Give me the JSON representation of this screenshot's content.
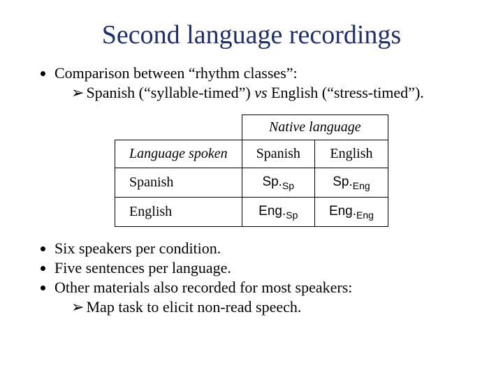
{
  "title": "Second language recordings",
  "bullet1": "Comparison between “rhythm classes”:",
  "bullet1_sub_a": "Spanish (“syllable-timed”) ",
  "bullet1_sub_vs": "vs",
  "bullet1_sub_b": " English (“stress-timed”).",
  "arrow": "➢",
  "table": {
    "native_header": "Native language",
    "row_header_label": "Language spoken",
    "col1": "Spanish",
    "col2": "English",
    "row1_label": "Spanish",
    "row2_label": "English",
    "c11_main": "Sp.",
    "c11_sub": "Sp",
    "c12_main": "Sp.",
    "c12_sub": "Eng",
    "c21_main": "Eng.",
    "c21_sub": "Sp",
    "c22_main": "Eng.",
    "c22_sub": "Eng"
  },
  "bullet2": "Six speakers per condition.",
  "bullet3": "Five sentences per language.",
  "bullet4": "Other materials also recorded for most speakers:",
  "bullet4_sub": "Map task to elicit non-read speech."
}
